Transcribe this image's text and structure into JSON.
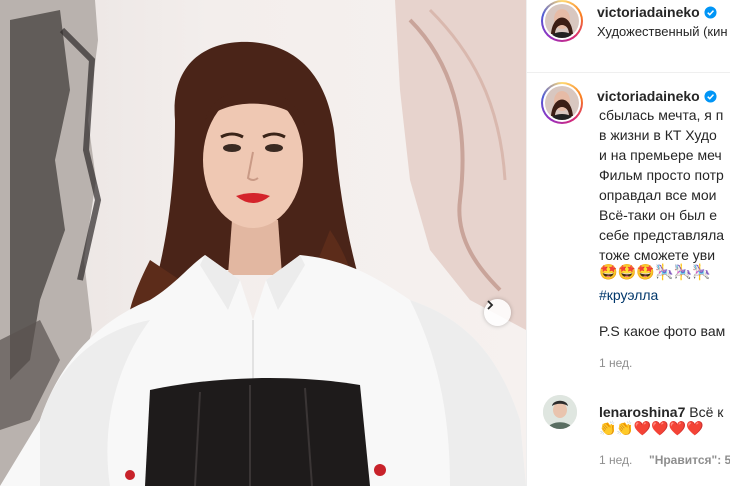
{
  "post": {
    "author": {
      "username": "victoriadaineko",
      "verified": true,
      "location": "Художественный (кин"
    },
    "caption": {
      "lines": [
        "сбылась мечта, я п",
        "в жизни в КТ Худо",
        "и на премьере меч",
        "Фильм просто потр",
        "оправдал все мои",
        "Всё-таки он был е",
        "себе представляла",
        "тоже сможете уви"
      ],
      "emoji_line": "🤩🤩🤩🎠🎠🎠",
      "hashtag": "#круэлла",
      "ps": "P.S какое фото вам",
      "age": "1 нед."
    },
    "comment": {
      "username": "lenaroshina7",
      "text": "Всё к",
      "emoji_line": "👏👏❤️❤️❤️❤️",
      "age": "1 нед.",
      "likes": "\"Нравится\": 5"
    }
  },
  "colors": {
    "text": "#262626",
    "secondary": "#8e8e8e",
    "hashtag": "#00376b",
    "verified": "#0095f6",
    "divider": "#efefef"
  },
  "icons": {
    "next": "chevron-right-icon",
    "verified": "verified-badge-icon"
  }
}
